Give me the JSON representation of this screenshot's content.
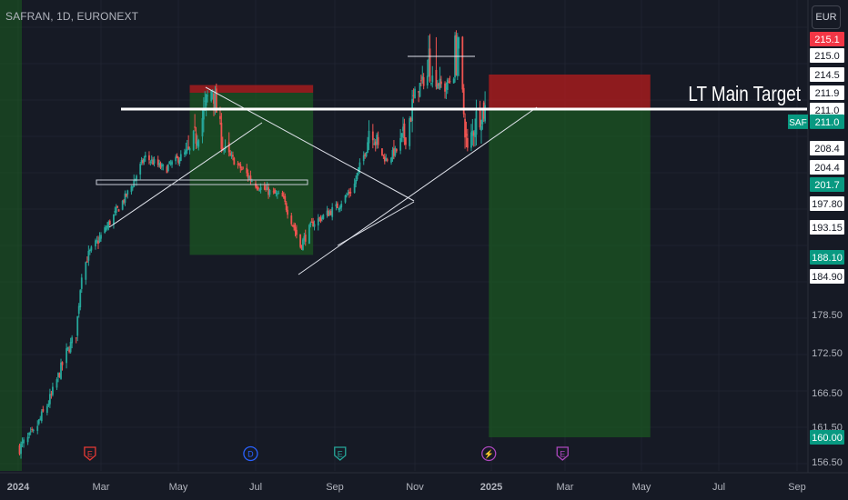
{
  "header": {
    "symbol_title": "SAFRAN, 1D, EURONEXT",
    "currency_label": "EUR"
  },
  "colors": {
    "background": "#161a25",
    "up_candle": "#26a69a",
    "down_candle": "#ef5350",
    "profit_zone": "#1b5e20",
    "loss_zone": "#b71c1c",
    "target_line": "#ffffff"
  },
  "chart_data": {
    "type": "candlestick",
    "symbol": "SAF",
    "interval": "1D",
    "exchange": "EURONEXT",
    "currency": "EUR",
    "ylim": [
      155,
      217
    ],
    "x_ticks": [
      "2024",
      "Mar",
      "May",
      "Jul",
      "Sep",
      "Nov",
      "2025",
      "Mar",
      "May",
      "Jul",
      "Sep"
    ],
    "y_ticks": [
      "156.50",
      "160.00",
      "161.50",
      "166.50",
      "172.50",
      "178.50",
      "184.90",
      "188.10",
      "193.15",
      "197.80",
      "201.7",
      "204.4",
      "208.4",
      "211.0",
      "211.9",
      "214.5",
      "215.0",
      "215.1"
    ],
    "last_price": 211.0,
    "price_path": [
      {
        "date": "2024-01-02",
        "price": 158.5
      },
      {
        "date": "2024-01-12",
        "price": 160.5
      },
      {
        "date": "2024-01-25",
        "price": 166.0
      },
      {
        "date": "2024-02-05",
        "price": 172.5
      },
      {
        "date": "2024-02-12",
        "price": 175.5
      },
      {
        "date": "2024-02-16",
        "price": 185.5
      },
      {
        "date": "2024-02-21",
        "price": 188.5
      },
      {
        "date": "2024-03-05",
        "price": 193.0
      },
      {
        "date": "2024-03-20",
        "price": 199.0
      },
      {
        "date": "2024-04-05",
        "price": 206.5
      },
      {
        "date": "2024-04-20",
        "price": 204.0
      },
      {
        "date": "2024-05-10",
        "price": 208.0
      },
      {
        "date": "2024-05-28",
        "price": 212.5
      },
      {
        "date": "2024-06-05",
        "price": 208.5
      },
      {
        "date": "2024-06-18",
        "price": 204.5
      },
      {
        "date": "2024-07-05",
        "price": 201.0
      },
      {
        "date": "2024-07-22",
        "price": 199.0
      },
      {
        "date": "2024-08-05",
        "price": 190.0
      },
      {
        "date": "2024-08-15",
        "price": 194.0
      },
      {
        "date": "2024-09-02",
        "price": 197.0
      },
      {
        "date": "2024-09-15",
        "price": 201.0
      },
      {
        "date": "2024-09-28",
        "price": 210.5
      },
      {
        "date": "2024-10-10",
        "price": 206.0
      },
      {
        "date": "2024-10-25",
        "price": 209.5
      },
      {
        "date": "2024-11-05",
        "price": 213.0
      },
      {
        "date": "2024-11-12",
        "price": 214.5
      },
      {
        "date": "2024-11-25",
        "price": 212.5
      },
      {
        "date": "2024-12-05",
        "price": 215.5
      },
      {
        "date": "2024-12-13",
        "price": 208.0
      },
      {
        "date": "2024-12-20",
        "price": 210.5
      },
      {
        "date": "2024-12-27",
        "price": 211.0
      }
    ],
    "price_labels": [
      {
        "value": 215.1,
        "text": "215.1",
        "style": "red"
      },
      {
        "value": 215.0,
        "text": "215.0",
        "style": "white"
      },
      {
        "value": 214.5,
        "text": "214.5",
        "style": "white"
      },
      {
        "value": 211.9,
        "text": "211.9",
        "style": "white"
      },
      {
        "value": 211.0,
        "text": "211.0",
        "style": "white"
      },
      {
        "value": 210.2,
        "text": "211.0",
        "style": "teal",
        "tag": "SAF"
      },
      {
        "value": 208.4,
        "text": "208.4",
        "style": "white"
      },
      {
        "value": 204.4,
        "text": "204.4",
        "style": "white"
      },
      {
        "value": 201.7,
        "text": "201.7",
        "style": "green"
      },
      {
        "value": 197.8,
        "text": "197.80",
        "style": "white"
      },
      {
        "value": 193.15,
        "text": "193.15",
        "style": "white"
      },
      {
        "value": 188.1,
        "text": "188.10",
        "style": "green"
      },
      {
        "value": 184.9,
        "text": "184.90",
        "style": "white"
      },
      {
        "value": 178.5,
        "text": "178.50",
        "style": "plain"
      },
      {
        "value": 172.5,
        "text": "172.50",
        "style": "plain"
      },
      {
        "value": 166.5,
        "text": "166.50",
        "style": "plain"
      },
      {
        "value": 161.5,
        "text": "161.50",
        "style": "plain"
      },
      {
        "value": 160.0,
        "text": "160.00",
        "style": "green"
      },
      {
        "value": 156.5,
        "text": "156.50",
        "style": "plain"
      }
    ],
    "annotations": {
      "target_label": "LT Main Target",
      "target_level": 211.0,
      "event_markers": [
        {
          "date": "2024-02-22",
          "label": "E",
          "color": "#e53935"
        },
        {
          "date": "2024-06-27",
          "label": "D",
          "color": "#2962ff"
        },
        {
          "date": "2024-09-05",
          "label": "E",
          "color": "#26a69a"
        },
        {
          "date": "2024-12-30",
          "label": "⚡",
          "color": "#ab47bc"
        },
        {
          "date": "2025-02-27",
          "label": "E",
          "color": "#ab47bc"
        }
      ],
      "long_position_1": {
        "start": "2024-05-10",
        "end": "2024-08-15",
        "entry": 211.9,
        "stop": 213.0,
        "target": 188.5
      },
      "long_position_2": {
        "start": "2024-12-30",
        "end": "2025-05-08",
        "entry": 211.0,
        "stop": 214.5,
        "target": 160.0
      }
    }
  }
}
